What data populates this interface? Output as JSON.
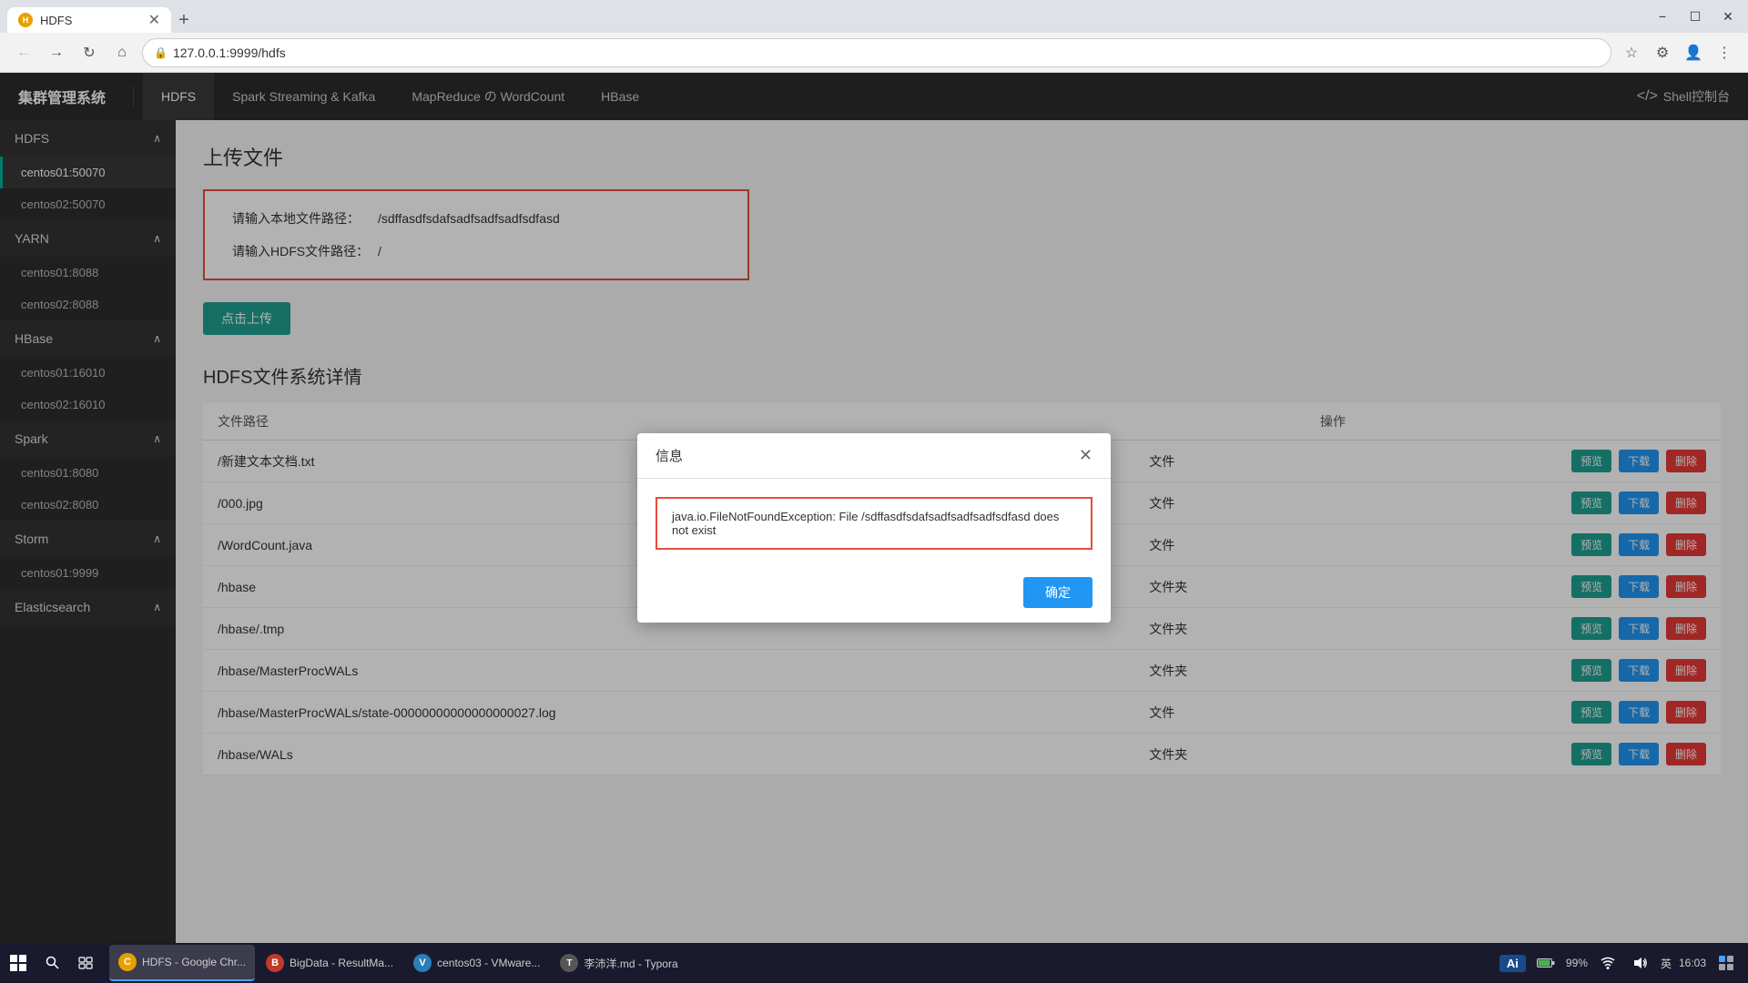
{
  "browser": {
    "tab": {
      "title": "HDFS",
      "icon_text": "H",
      "icon_color": "#e8a000"
    },
    "address": "127.0.0.1:9999/hdfs",
    "new_tab_label": "+"
  },
  "topnav": {
    "brand": "集群管理系统",
    "items": [
      {
        "label": "HDFS",
        "active": true
      },
      {
        "label": "Spark Streaming & Kafka",
        "active": false
      },
      {
        "label": "MapReduce の WordCount",
        "active": false
      },
      {
        "label": "HBase",
        "active": false
      }
    ],
    "shell_label": "Shell控制台"
  },
  "sidebar": {
    "groups": [
      {
        "label": "HDFS",
        "expanded": true,
        "items": [
          "centos01:50070",
          "centos02:50070"
        ]
      },
      {
        "label": "YARN",
        "expanded": true,
        "items": [
          "centos01:8088",
          "centos02:8088"
        ]
      },
      {
        "label": "HBase",
        "expanded": true,
        "items": [
          "centos01:16010",
          "centos02:16010"
        ]
      },
      {
        "label": "Spark",
        "expanded": true,
        "items": [
          "centos01:8080",
          "centos02:8080"
        ]
      },
      {
        "label": "Storm",
        "expanded": true,
        "items": [
          "centos01:9999"
        ]
      },
      {
        "label": "Elasticsearch",
        "expanded": true,
        "items": []
      }
    ]
  },
  "main": {
    "page_title": "上传文件",
    "upload_form": {
      "local_path_label": "请输入本地文件路径：",
      "local_path_value": "/sdffasdfsdafsadfsadfsadfsdfasd",
      "hdfs_path_label": "请输入HDFS文件路径：",
      "hdfs_path_value": "/",
      "upload_button": "点击上传"
    },
    "file_section_title": "HDFS文件系统详情",
    "table": {
      "columns": [
        "文件路径",
        "",
        "操作"
      ],
      "rows": [
        {
          "path": "/新建文本文档.txt",
          "type": "文件"
        },
        {
          "path": "/000.jpg",
          "type": "文件"
        },
        {
          "path": "/WordCount.java",
          "type": "文件"
        },
        {
          "path": "/hbase",
          "type": "文件夹"
        },
        {
          "path": "/hbase/.tmp",
          "type": "文件夹"
        },
        {
          "path": "/hbase/MasterProcWALs",
          "type": "文件夹"
        },
        {
          "path": "/hbase/MasterProcWALs/state-00000000000000000027.log",
          "type": "文件"
        },
        {
          "path": "/hbase/WALs",
          "type": "文件夹"
        }
      ],
      "btn_preview": "预览",
      "btn_download": "下载",
      "btn_delete": "删除"
    }
  },
  "dialog": {
    "title": "信息",
    "error_message": "java.io.FileNotFoundException: File /sdffasdfsdafsadfsadfsadfsdfasd does not exist",
    "confirm_button": "确定"
  },
  "taskbar": {
    "apps": [
      {
        "label": "HDFS - Google Chr...",
        "icon_color": "#e8a000",
        "icon_text": "C",
        "active": true
      },
      {
        "label": "BigData - ResultMa...",
        "icon_color": "#c0392b",
        "icon_text": "B",
        "active": false
      },
      {
        "label": "centos03 - VMware...",
        "icon_color": "#2980b9",
        "icon_text": "V",
        "active": false
      },
      {
        "label": "李沛洋.md - Typora",
        "icon_color": "#555",
        "icon_text": "T",
        "active": false
      }
    ],
    "ai_badge": "Ai",
    "battery": "99%",
    "language": "英",
    "time": "16:03"
  }
}
